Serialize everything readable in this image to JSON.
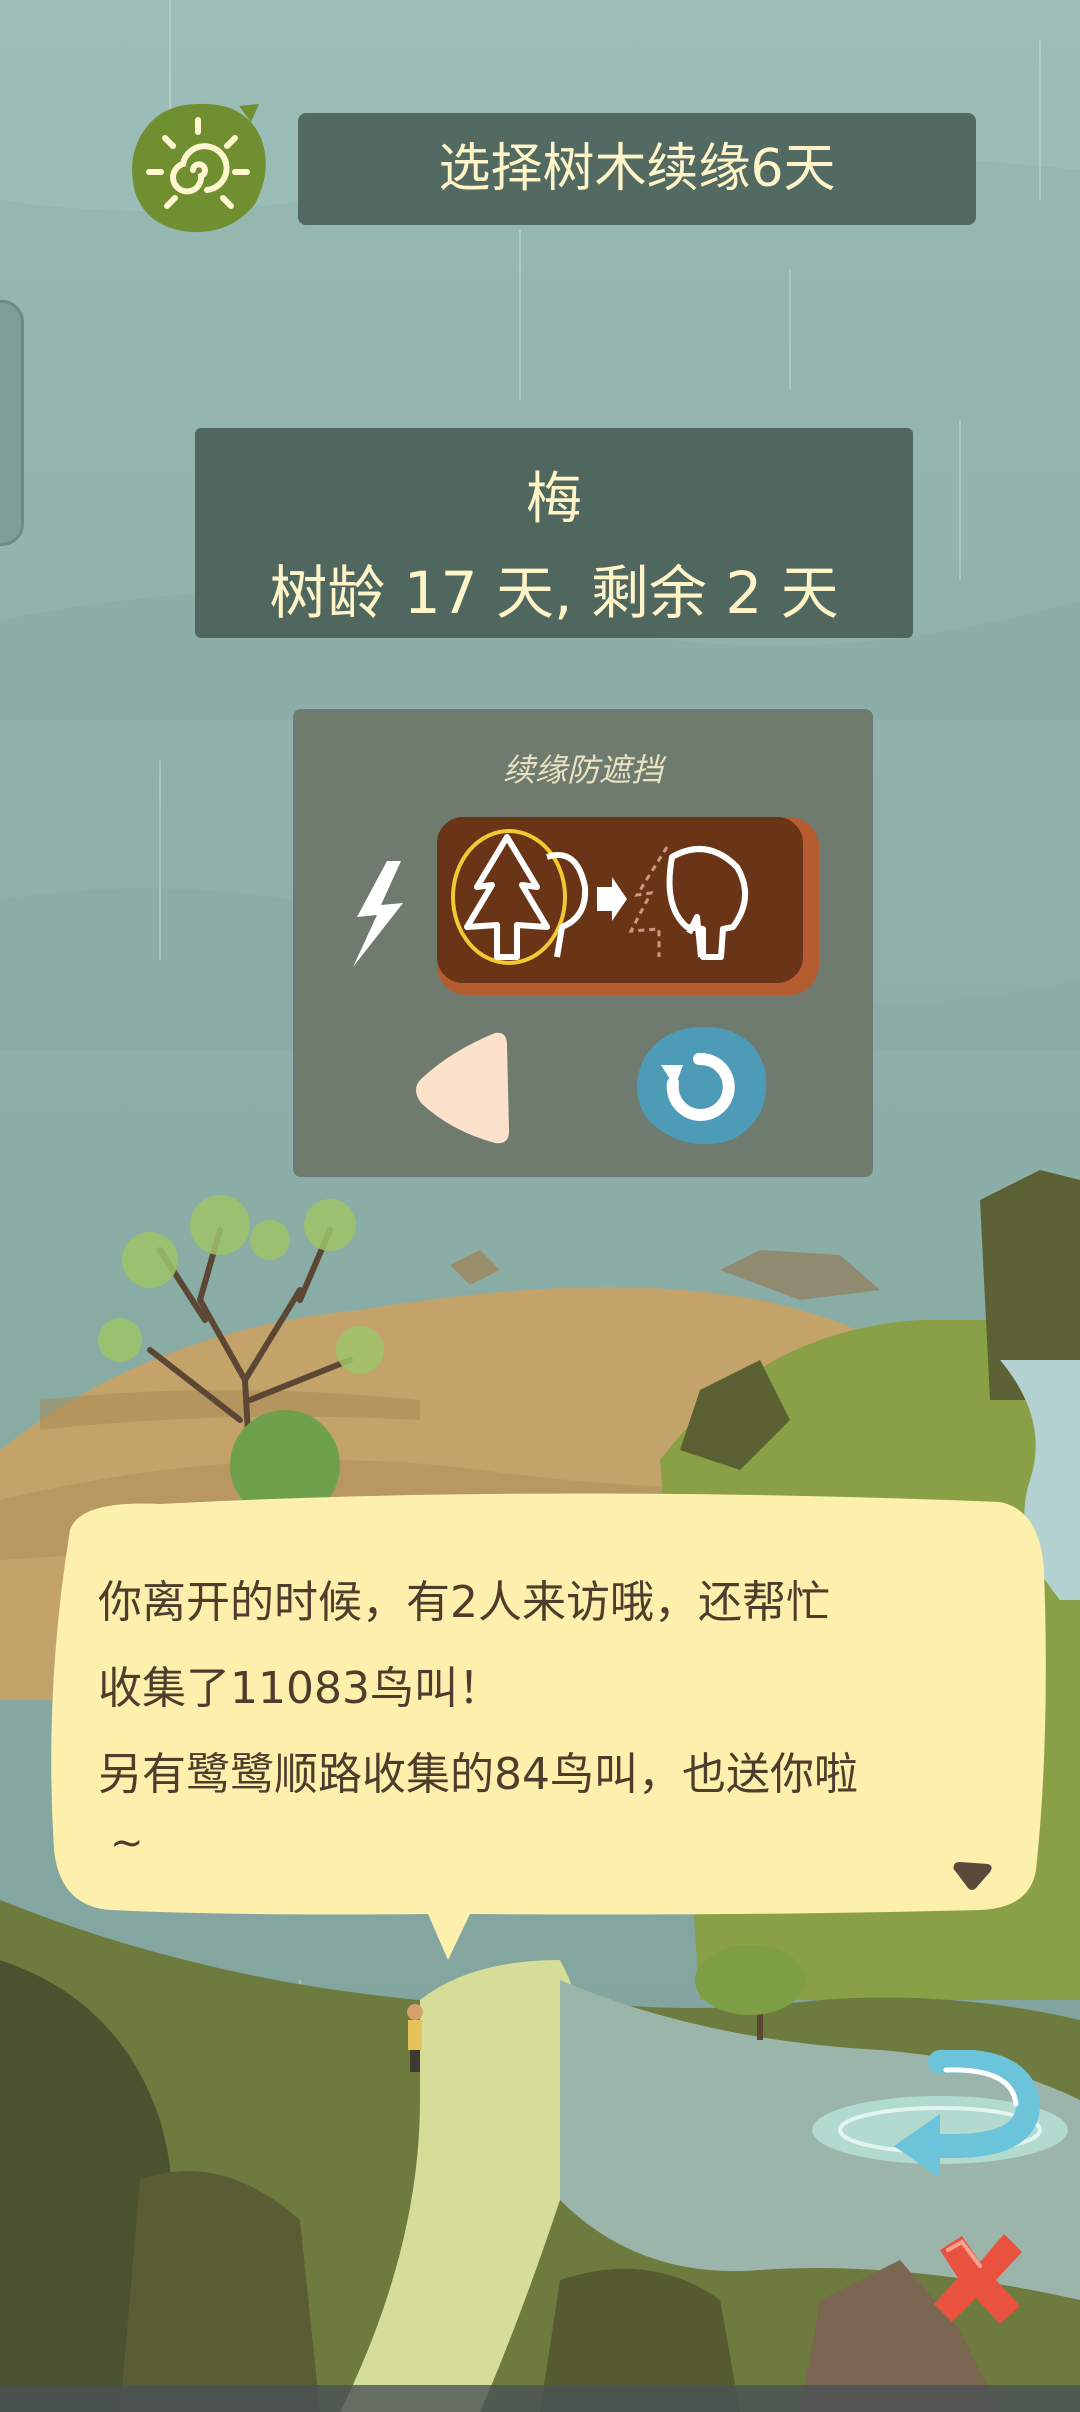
{
  "header": {
    "title": "选择树木续缘6天",
    "sun_icon": "sun-swirl-icon"
  },
  "tree": {
    "name": "梅",
    "age_text": "树龄 17 天, 剩余 2 天"
  },
  "shield": {
    "title": "续缘防遮挡",
    "power_icon": "lightning-icon",
    "button_icon": "tree-switch-icon",
    "prev_icon": "triangle-left-icon",
    "refresh_icon": "refresh-icon"
  },
  "dialog": {
    "text": "你离开的时候，有2人来访哦，还帮忙\n收集了11083鸟叫！\n另有鹭鹭顺路收集的84鸟叫，也送你啦",
    "tilde": "~",
    "arrow_icon": "triangle-down-icon"
  },
  "controls": {
    "return_icon": "return-arrow-icon",
    "close_icon": "close-icon"
  },
  "colors": {
    "panel_dark": "#526a62",
    "text_cream": "#fff3c8",
    "dialog_bg": "#fdf0ad",
    "close_red": "#e9523e",
    "button_brown": "#6a3417"
  }
}
